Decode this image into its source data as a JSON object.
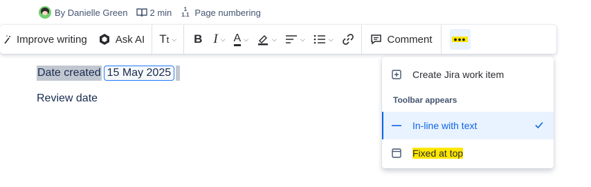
{
  "byline": {
    "author": "By Danielle Green",
    "read_time": "2 min",
    "page_numbering": "Page numbering"
  },
  "toolbar": {
    "improve_writing": "Improve writing",
    "ask_ai": "Ask AI",
    "comment": "Comment"
  },
  "content": {
    "date_created_label": "Date created",
    "date_created_value": "15 May 2025",
    "review_date_label": "Review date"
  },
  "menu": {
    "create_jira": "Create Jira work item",
    "section_header": "Toolbar appears",
    "inline_option": "In-line with text",
    "fixed_option": "Fixed at top",
    "selected": "In-line with text"
  },
  "colors": {
    "accent": "#0c66e4",
    "highlight": "#ffe700",
    "selection_bg": "#c1c7d0",
    "selected_item_bg": "#e9f2ff"
  }
}
